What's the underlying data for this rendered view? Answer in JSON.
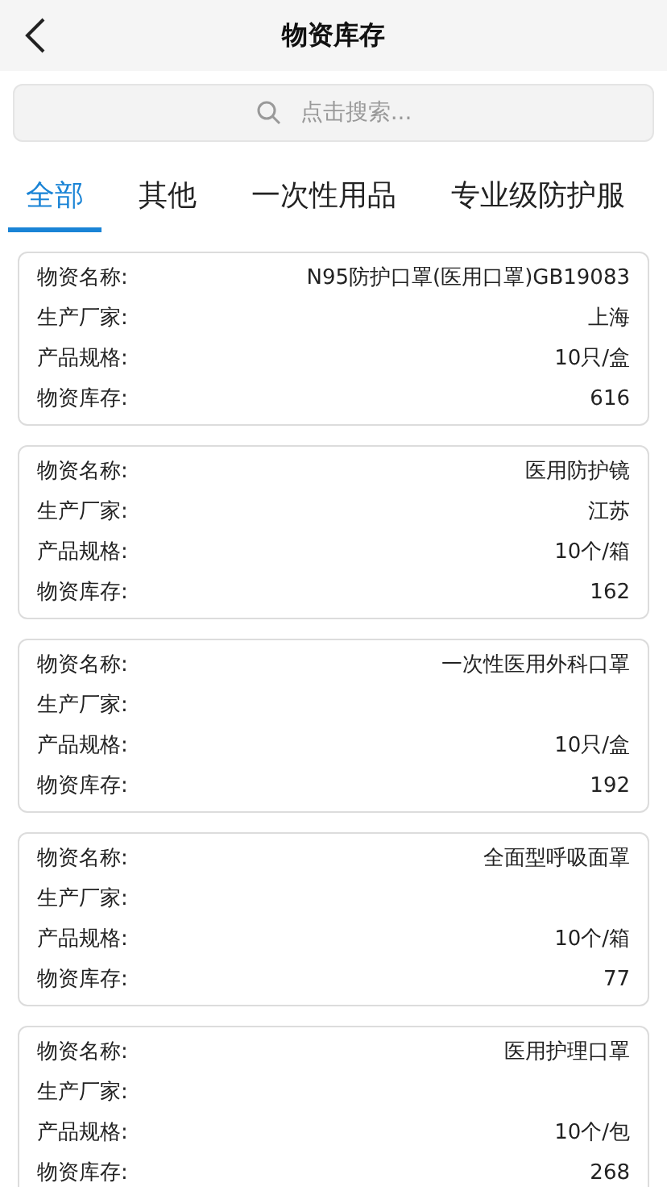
{
  "header": {
    "title": "物资库存"
  },
  "search": {
    "placeholder": "点击搜索..."
  },
  "tabs": [
    {
      "label": "全部",
      "selected": true
    },
    {
      "label": "其他",
      "selected": false
    },
    {
      "label": "一次性用品",
      "selected": false
    },
    {
      "label": "专业级防护服",
      "selected": false
    }
  ],
  "items": [
    {
      "fields": [
        {
          "label": "物资名称:",
          "value": "N95防护口罩(医用口罩)GB19083"
        },
        {
          "label": "生产厂家:",
          "value": "上海"
        },
        {
          "label": "产品规格:",
          "value": "10只/盒"
        },
        {
          "label": "物资库存:",
          "value": "616"
        }
      ]
    },
    {
      "fields": [
        {
          "label": "物资名称:",
          "value": "医用防护镜"
        },
        {
          "label": "生产厂家:",
          "value": "江苏"
        },
        {
          "label": "产品规格:",
          "value": "10个/箱"
        },
        {
          "label": "物资库存:",
          "value": "162"
        }
      ]
    },
    {
      "fields": [
        {
          "label": "物资名称:",
          "value": "一次性医用外科口罩"
        },
        {
          "label": "生产厂家:"
        },
        {
          "label": "产品规格:",
          "value": "10只/盒"
        },
        {
          "label": "物资库存:",
          "value": "192"
        }
      ]
    },
    {
      "fields": [
        {
          "label": "物资名称:",
          "value": "全面型呼吸面罩"
        },
        {
          "label": "生产厂家:"
        },
        {
          "label": "产品规格:",
          "value": "10个/箱"
        },
        {
          "label": "物资库存:",
          "value": "77"
        }
      ]
    },
    {
      "fields": [
        {
          "label": "物资名称:",
          "value": "医用护理口罩"
        },
        {
          "label": "生产厂家:"
        },
        {
          "label": "产品规格:",
          "value": "10个/包"
        },
        {
          "label": "物资库存:",
          "value": "268"
        }
      ]
    }
  ]
}
